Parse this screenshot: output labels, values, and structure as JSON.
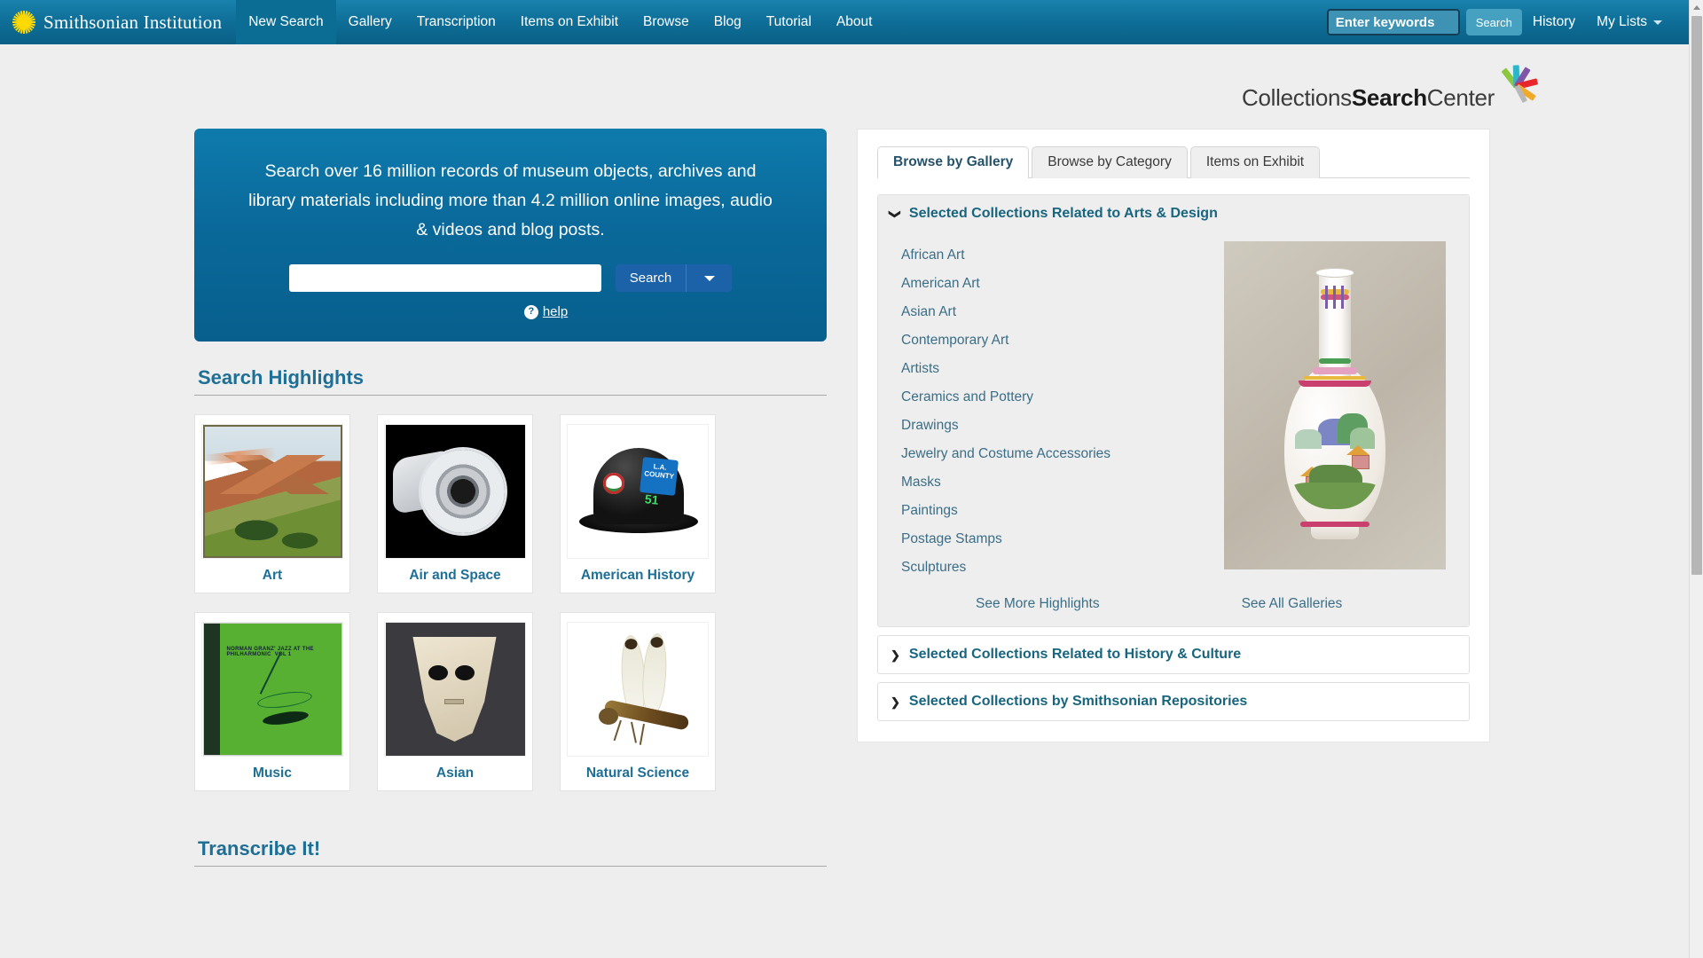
{
  "header": {
    "brand": "Smithsonian Institution",
    "brand_icon": "sun-icon",
    "nav": [
      {
        "label": "New Search",
        "active": true
      },
      {
        "label": "Gallery",
        "active": false
      },
      {
        "label": "Transcription",
        "active": false
      },
      {
        "label": "Items on Exhibit",
        "active": false
      },
      {
        "label": "Browse",
        "active": false
      },
      {
        "label": "Blog",
        "active": false
      },
      {
        "label": "Tutorial",
        "active": false
      },
      {
        "label": "About",
        "active": false
      }
    ],
    "keyword_placeholder": "Enter keywords",
    "keyword_value": "",
    "search_label": "Search",
    "history_label": "History",
    "my_lists_label": "My Lists"
  },
  "logo": {
    "text_part1": "Collections",
    "text_part2": "Search",
    "text_part3": "Center",
    "burst_colors": [
      "#8dc63f",
      "#2eb5c9",
      "#7e57a6",
      "#e8262b",
      "#f0a92a",
      "#b8b8b8"
    ]
  },
  "search_box": {
    "blurb": "Search over 16 million records of museum objects, archives and library materials including more than 4.2 million online images, audio & videos and blog posts.",
    "input_value": "",
    "input_placeholder": "",
    "search_label": "Search",
    "dropdown_icon": "chevron-down-icon",
    "help_label": "help",
    "help_icon": "question-mark-icon"
  },
  "highlights": {
    "title": "Search Highlights",
    "cards": [
      {
        "label": "Art",
        "thumb": "landscape-painting"
      },
      {
        "label": "Air and Space",
        "thumb": "jet-engine"
      },
      {
        "label": "American History",
        "thumb": "firefighter-helmet"
      },
      {
        "label": "Music",
        "thumb": "jazz-album-cover"
      },
      {
        "label": "Asian",
        "thumb": "carved-jade-mask"
      },
      {
        "label": "Natural Science",
        "thumb": "dragonfly-specimen"
      }
    ]
  },
  "transcribe": {
    "title": "Transcribe It!"
  },
  "right_panel": {
    "tabs": [
      {
        "label": "Browse by Gallery",
        "active": true
      },
      {
        "label": "Browse by Category",
        "active": false
      },
      {
        "label": "Items on Exhibit",
        "active": false
      }
    ],
    "accordions": [
      {
        "title": "Selected Collections Related to Arts & Design",
        "open": true,
        "chevron": "chevron-down-icon",
        "links": [
          "African Art",
          "American Art",
          "Asian Art",
          "Contemporary Art",
          "Artists",
          "Ceramics and Pottery",
          "Drawings",
          "Jewelry and Costume Accessories",
          "Masks",
          "Paintings",
          "Postage Stamps",
          "Sculptures"
        ],
        "image_alt": "famille-rose-porcelain-vase",
        "footer_links": [
          "See More Highlights",
          "See All Galleries"
        ]
      },
      {
        "title": "Selected Collections Related to History & Culture",
        "open": false,
        "chevron": "chevron-right-icon"
      },
      {
        "title": "Selected Collections by Smithsonian Repositories",
        "open": false,
        "chevron": "chevron-right-icon"
      }
    ]
  },
  "scrollbar": {
    "up_icon": "triangle-up-icon"
  },
  "colors": {
    "nav_blue": "#0e6e97",
    "panel_blue": "#0a699a",
    "link_blue": "#3b6e87",
    "heading_blue": "#1e6f96",
    "button_blue": "#1b62a8"
  }
}
